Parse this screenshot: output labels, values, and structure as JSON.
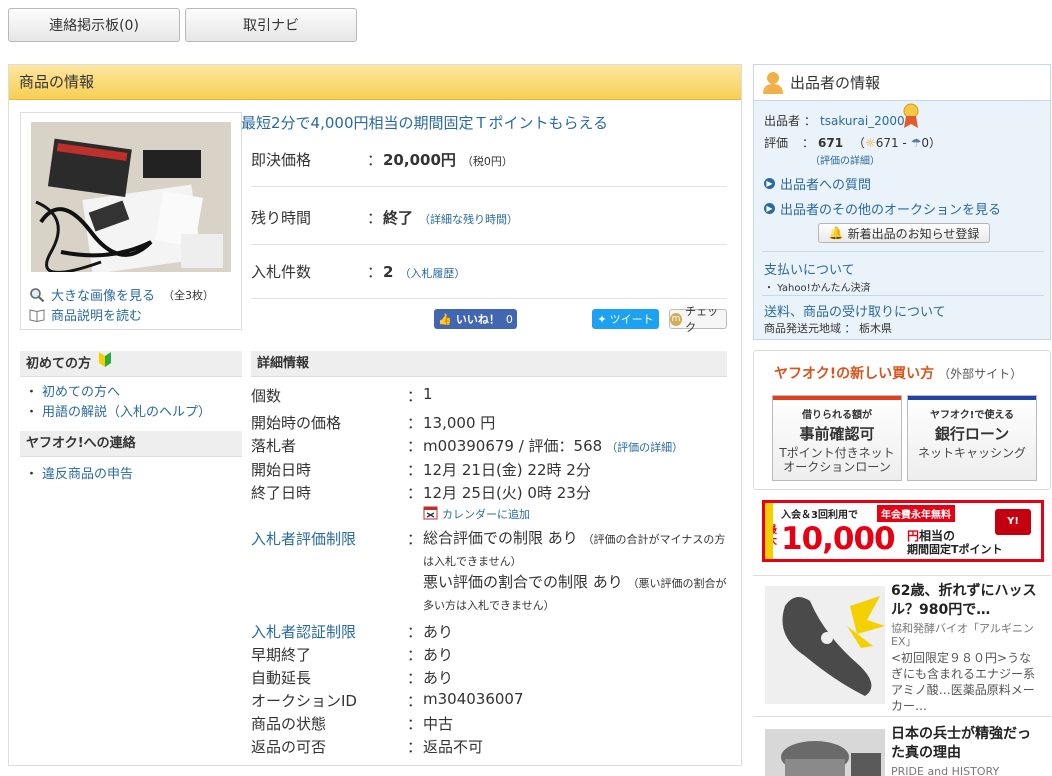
{
  "tabs": {
    "messages": "連絡掲示板(0)",
    "navi": "取引ナビ"
  },
  "item": {
    "panel_title": "商品の情報",
    "promo": "最短2分で4,000円相当の期間固定Ｔポイントもらえる",
    "photo_links": {
      "large": "大きな画像を見る",
      "count": "（全3枚）",
      "desc": "商品説明を読む"
    },
    "price": {
      "label": "即決価格",
      "sep": "：",
      "value": "20,000円",
      "tax": "（税0円）"
    },
    "time": {
      "label": "残り時間",
      "sep": "：",
      "value": "終了",
      "link": "（詳細な残り時間）"
    },
    "bids": {
      "label": "入札件数",
      "sep": "：",
      "value": "2",
      "link": "（入札履歴）"
    },
    "social": {
      "like": "いいね！",
      "like_count": "0",
      "tweet": "ツイート",
      "check": "チェック"
    }
  },
  "sidebar": {
    "first_title": "初めての方",
    "first_links": [
      "初めての方へ",
      "用語の解説（入札のヘルプ）"
    ],
    "contact_title": "ヤフオク!への連絡",
    "contact_links": [
      "違反商品の申告"
    ]
  },
  "details": {
    "title": "詳細情報",
    "rows": [
      {
        "label": "個数",
        "value": "1"
      },
      {
        "label": "開始時の価格",
        "value": "13,000 円"
      },
      {
        "label": "落札者",
        "value": "m00390679 / 評価：568",
        "link": "（評価の詳細）"
      },
      {
        "label": "開始日時",
        "value": "12月 21日(金) 22時 2分"
      },
      {
        "label": "終了日時",
        "value": "12月 25日(火) 0時 23分",
        "link": "カレンダーに追加"
      },
      {
        "label": "入札者評価制限",
        "value": "総合評価での制限 あり",
        "note": "（評価の合計がマイナスの方は入札できません）",
        "value2": "悪い評価の割合での制限 あり",
        "note2": "（悪い評価の割合が多い方は入札できません）"
      },
      {
        "label": "入札者認証制限",
        "value": "あり"
      },
      {
        "label": "早期終了",
        "value": "あり"
      },
      {
        "label": "自動延長",
        "value": "あり"
      },
      {
        "label": "オークションID",
        "value": "m304036007"
      },
      {
        "label": "商品の状態",
        "value": "中古"
      },
      {
        "label": "返品の可否",
        "value": "返品不可"
      }
    ],
    "sep": "："
  },
  "seller": {
    "title": "出品者の情報",
    "name_label": "出品者",
    "name_sep": "：",
    "name": "tsakurai_2000",
    "rating_label": "評価",
    "rating_sep": "：",
    "rating": "671",
    "rating_good": "671",
    "rating_bad": "0",
    "rating_open": "（",
    "rating_mid": " - ",
    "rating_close": "）",
    "rating_link": "（評価の詳細）",
    "question_link": "出品者への質問",
    "other_link": "出品者のその他のオークションを見る",
    "notify": "新着出品のお知らせ登録",
    "payment_title": "支払いについて",
    "payment_method": "・ Yahoo!かんたん決済",
    "shipping_title": "送料、商品の受け取りについて",
    "shipping_region": "商品発送元地域 ： 栃木県"
  },
  "new_way": {
    "title": "ヤフオク!の新しい買い方",
    "external": "（外部サイト）",
    "card1": {
      "t1": "借りられる額が",
      "t2": "事前確認可",
      "t3a": "Tポイント付きネット",
      "t3b": "オークションローン",
      "color": "#e2401c"
    },
    "card2": {
      "t1": "ヤフオク!で使える",
      "t2": "銀行ローン",
      "t3a": "ネットキャッシング",
      "color": "#2443a6"
    }
  },
  "banner": {
    "line1": "入会＆3回利用で",
    "line1b": "年会費永年無料",
    "max": "最大",
    "amount": "10,000",
    "unit": "円",
    "suffix_a": "相当の",
    "suffix_b": "期間固定Tポイント",
    "brand": "Y!"
  },
  "news": [
    {
      "title": "62歳、折れずにハッスル？980円で…",
      "source": "協和発酵バイオ「アルギニンEX」",
      "desc": "<初回限定９８０円>うなぎにも含まれるエナジー系アミノ酸…医薬品原料メーカー…"
    },
    {
      "title": "日本の兵士が精強だった真の理由",
      "source": "PRIDE and HISTORY"
    }
  ]
}
